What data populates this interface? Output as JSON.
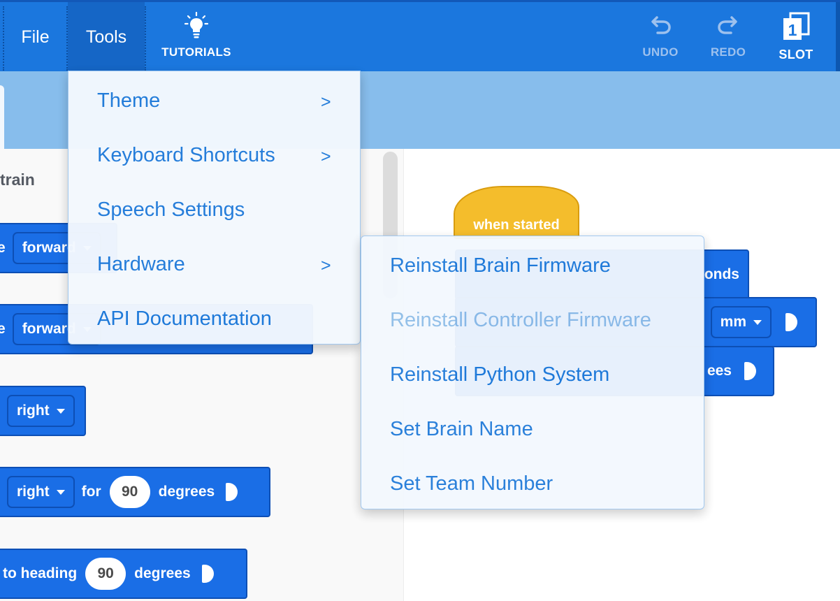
{
  "toolbar": {
    "file_label": "File",
    "tools_label": "Tools",
    "tutorials_label": "TUTORIALS",
    "undo_label": "UNDO",
    "redo_label": "REDO",
    "slot_label": "SLOT",
    "slot_number": "1"
  },
  "palette": {
    "category_label": "train",
    "blocks": [
      {
        "prefix": "e",
        "dropdown": "forward"
      },
      {
        "prefix": "e",
        "dropdown": "forward"
      },
      {
        "dropdown": "right"
      },
      {
        "dropdown": "right",
        "mid": "for",
        "value": "90",
        "suffix": "degrees"
      },
      {
        "prefix": "to heading",
        "value": "90",
        "suffix": "degrees"
      }
    ]
  },
  "canvas": {
    "hat_label": "when started",
    "block1_suffix": "onds",
    "block2_dropdown": "mm",
    "block3_suffix": "ees"
  },
  "tools_menu": {
    "items": [
      {
        "label": "Theme",
        "arrow": ">"
      },
      {
        "label": "Keyboard Shortcuts",
        "arrow": ">"
      },
      {
        "label": "Speech Settings"
      },
      {
        "label": "Hardware",
        "arrow": ">"
      },
      {
        "label": "API Documentation"
      }
    ]
  },
  "hardware_menu": {
    "items": [
      {
        "label": "Reinstall Brain Firmware",
        "enabled": true
      },
      {
        "label": "Reinstall Controller Firmware",
        "enabled": false
      },
      {
        "label": "Reinstall Python System",
        "enabled": true
      },
      {
        "label": "Set Brain Name",
        "enabled": true
      },
      {
        "label": "Set Team Number",
        "enabled": true
      }
    ]
  },
  "colors": {
    "toolbar": "#1b77de",
    "accent_band": "#87bdec",
    "block_blue": "#1a6ee6",
    "hat_yellow": "#f4bd2c",
    "menu_text": "#1f7ad9",
    "menu_text_disabled": "#8ebde8"
  }
}
